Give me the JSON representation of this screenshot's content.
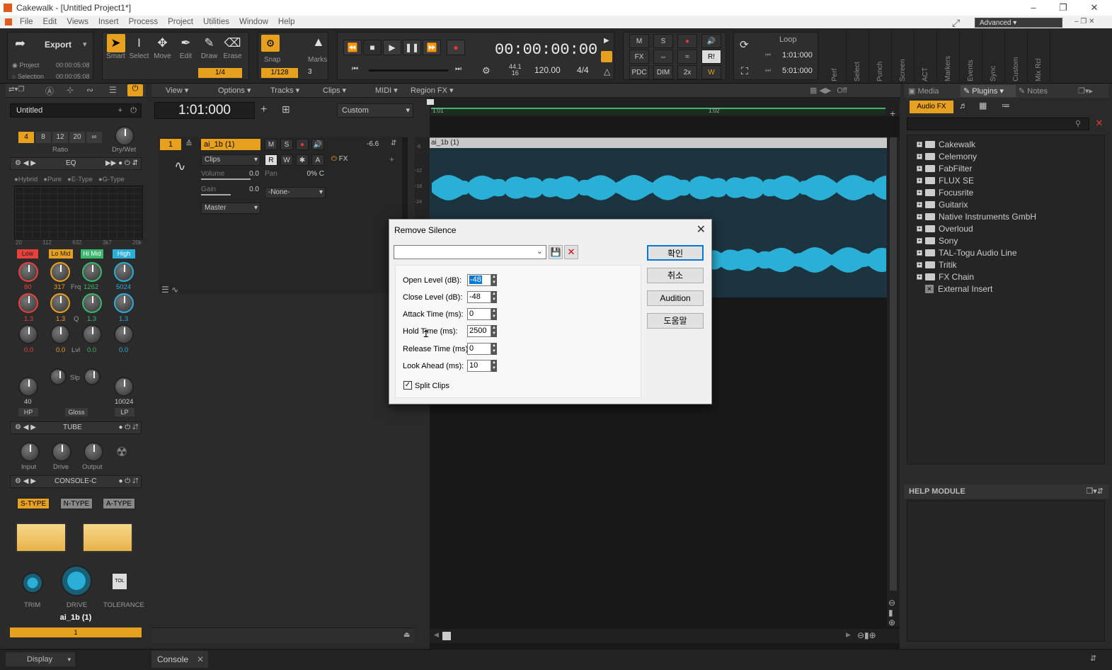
{
  "window": {
    "title": "Cakewalk - [Untitled Project1*]"
  },
  "menu": [
    "File",
    "Edit",
    "Views",
    "Insert",
    "Process",
    "Project",
    "Utilities",
    "Window",
    "Help"
  ],
  "workspace": "Advanced",
  "control_bar": {
    "export": {
      "label": "Export",
      "project_label": "Project",
      "project_time": "00:00:05:08",
      "selection_label": "Selection",
      "selection_time": "00:00:05:08"
    },
    "tools": [
      {
        "name": "Smart",
        "icon": "arrow-icon",
        "selected": true
      },
      {
        "name": "Select",
        "icon": "ibeam-icon",
        "selected": false
      },
      {
        "name": "Move",
        "icon": "move-icon",
        "selected": false
      },
      {
        "name": "Edit",
        "icon": "edit-icon",
        "selected": false
      },
      {
        "name": "Draw",
        "icon": "pencil-icon",
        "selected": false
      },
      {
        "name": "Erase",
        "icon": "eraser-icon",
        "selected": false
      }
    ],
    "snap_value": "1/4",
    "snap_label": "Snap",
    "marks_label": "Marks",
    "nudge_value": "1/128",
    "nudge_count": "3",
    "time_display": "00:00:00:00",
    "sample_rate": "44.1",
    "bit_depth": "16",
    "tempo": "120.00",
    "meter": "4/4",
    "mix_buttons": [
      "M",
      "S",
      "FX",
      "PDC",
      "DIM",
      "2x"
    ],
    "loop_label": "Loop",
    "loop_start": "1:01:000",
    "loop_end": "5:01:000",
    "vertical_tabs": [
      "Perf",
      "Select",
      "Punch",
      "Screen",
      "ACT",
      "Markers",
      "Events",
      "Sync",
      "Custom",
      "Mix Rcl"
    ]
  },
  "inspector": {
    "preset_name": "Untitled",
    "ratio_buttons": [
      "4",
      "8",
      "12",
      "20",
      "∞"
    ],
    "ratio_label": "Ratio",
    "drywet_label": "Dry/Wet",
    "eq_label": "EQ",
    "eq_modes": [
      "Hybrid",
      "Pure",
      "E-Type",
      "G-Type"
    ],
    "eq_freq_ticks": [
      "20",
      "112",
      "632",
      "3k7",
      "20k"
    ],
    "eq_bands": [
      {
        "name": "Low",
        "color": "#e8403a",
        "freq": "80",
        "q": "1.3",
        "gain": "0.0"
      },
      {
        "name": "Lo Mid",
        "color": "#e8a11e",
        "freq": "317",
        "q": "1.3",
        "gain": "0.0"
      },
      {
        "name": "Hi Mid",
        "color": "#3ab86b",
        "freq": "1262",
        "q": "1.3",
        "gain": "0.0"
      },
      {
        "name": "High",
        "color": "#2ab0d6",
        "freq": "5024",
        "q": "1.3",
        "gain": "0.0"
      }
    ],
    "frq_label": "Frq",
    "q_label": "Q",
    "lvl_label": "Lvl",
    "slp_label": "Slp",
    "hp_value": "40",
    "lp_value": "10024",
    "hp_label": "HP",
    "gloss_label": "Gloss",
    "lp_label": "LP",
    "tube_label": "TUBE",
    "tube_knobs": [
      "Input",
      "Drive",
      "Output"
    ],
    "console_label": "CONSOLE-C",
    "console_types": [
      "S-TYPE",
      "N-TYPE",
      "A-TYPE"
    ],
    "console_knobs": [
      "TRIM",
      "DRIVE",
      "TOLERANCE"
    ],
    "tol_label": "TOL",
    "track_name": "ai_1b (1)",
    "track_number": "1",
    "display_label": "Display"
  },
  "track_view": {
    "menus": [
      "View",
      "Options",
      "Tracks",
      "Clips",
      "MIDI",
      "Region FX"
    ],
    "now_time": "1:01:000",
    "custom_label": "Custom",
    "off_label": "Off",
    "ruler": [
      "1:01",
      "1:02"
    ],
    "track": {
      "number": "1",
      "name": "ai_1b (1)",
      "m": "M",
      "s": "S",
      "level": "-6.6",
      "mode": "Clips",
      "rw": [
        "R",
        "W",
        "A"
      ],
      "fx_label": "FX",
      "volume_label": "Volume",
      "volume_value": "0.0",
      "pan_label": "Pan",
      "pan_value": "0% C",
      "gain_label": "Gain",
      "gain_value": "0.0",
      "input": "-None-",
      "output": "Master"
    },
    "clip_name": "ai_1b (1)",
    "db_ticks": [
      "-6",
      "-12",
      "-18",
      "-24"
    ]
  },
  "browser": {
    "tabs": [
      "Media",
      "Plugins",
      "Notes"
    ],
    "audio_fx_label": "Audio FX",
    "plugins": [
      "Cakewalk",
      "Celemony",
      "FabFilter",
      "FLUX SE",
      "Focusrite",
      "Guitarix",
      "Native Instruments GmbH",
      "Overloud",
      "Sony",
      "TAL-Togu Audio Line",
      "Tritik",
      "FX Chain"
    ],
    "external_insert": "External Insert",
    "help_module_title": "HELP MODULE"
  },
  "dialog": {
    "title": "Remove Silence",
    "preset_value": "",
    "fields": [
      {
        "label": "Open Level (dB):",
        "value": "-48"
      },
      {
        "label": "Close Level (dB):",
        "value": "-48"
      },
      {
        "label": "Attack Time (ms):",
        "value": "0"
      },
      {
        "label": "Hold Time (ms):",
        "value": "2500"
      },
      {
        "label": "Release Time (ms):",
        "value": "0"
      },
      {
        "label": "Look Ahead (ms):",
        "value": "10"
      }
    ],
    "split_clips_label": "Split Clips",
    "split_clips_checked": true,
    "buttons": {
      "ok": "확인",
      "cancel": "취소",
      "audition": "Audition",
      "help": "도움말"
    }
  },
  "bottom": {
    "console_tab": "Console"
  }
}
